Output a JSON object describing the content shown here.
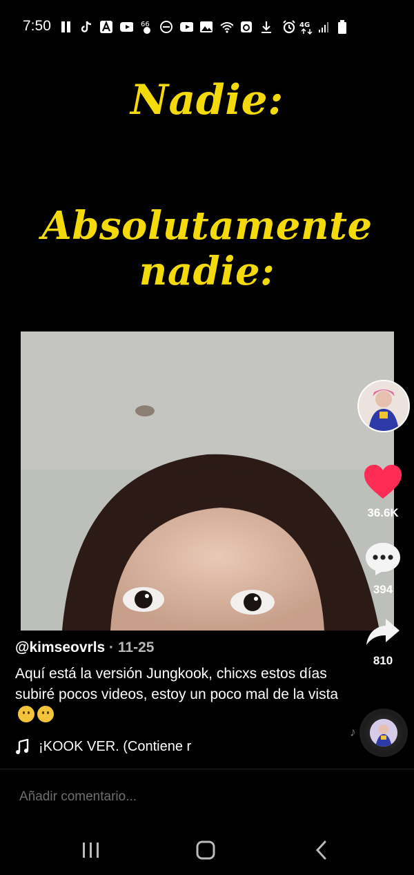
{
  "status_bar": {
    "time": "7:50",
    "left_icons": [
      "app-icon",
      "tiktok-icon",
      "a-app-icon",
      "youtube-icon",
      "notification-icon",
      "dnd-icon",
      "youtube-icon",
      "gallery-icon",
      "wifi-icon",
      "cast-icon",
      "download-icon"
    ],
    "right_icons": [
      "alarm-icon",
      "4g-icon",
      "signal-icon",
      "battery-icon"
    ]
  },
  "video": {
    "line1": "Nadie:",
    "line2a": "Absolutamente",
    "line2b": "nadie:"
  },
  "actions": {
    "likes": "36.6K",
    "comments": "394",
    "shares": "810"
  },
  "post": {
    "username": "@kimseovrls",
    "date_sep": " · ",
    "date": "11-25",
    "caption": "Aquí está la versión Jungkook, chicxs estos días subiré pocos videos, estoy un poco mal de la vista",
    "sound": "¡KOOK VER. (Contiene r"
  },
  "comment_bar": {
    "placeholder": "Añadir comentario..."
  },
  "colors": {
    "meme_text": "#f4d90b",
    "like_red": "#fe2c55"
  }
}
